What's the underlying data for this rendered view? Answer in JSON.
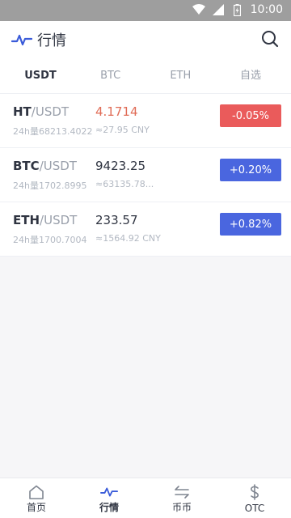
{
  "status": {
    "time": "10:00"
  },
  "header": {
    "title": "行情"
  },
  "tabs": [
    {
      "label": "USDT",
      "active": true
    },
    {
      "label": "BTC",
      "active": false
    },
    {
      "label": "ETH",
      "active": false
    },
    {
      "label": "自选",
      "active": false
    }
  ],
  "rows": [
    {
      "base": "HT",
      "quote": "/USDT",
      "volume": "24h量68213.4022",
      "price": "4.1714",
      "cny": "≈27.95 CNY",
      "change": "-0.05%",
      "direction": "down"
    },
    {
      "base": "BTC",
      "quote": "/USDT",
      "volume": "24h量1702.8995",
      "price": "9423.25",
      "cny": "≈63135.78...",
      "change": "+0.20%",
      "direction": "up"
    },
    {
      "base": "ETH",
      "quote": "/USDT",
      "volume": "24h量1700.7004",
      "price": "233.57",
      "cny": "≈1564.92 CNY",
      "change": "+0.82%",
      "direction": "up"
    }
  ],
  "bottom_nav": [
    {
      "label": "首页",
      "icon": "home-icon",
      "active": false
    },
    {
      "label": "行情",
      "icon": "market-pulse-icon",
      "active": true
    },
    {
      "label": "币币",
      "icon": "exchange-icon",
      "active": false
    },
    {
      "label": "OTC",
      "icon": "dollar-icon",
      "active": false
    }
  ],
  "colors": {
    "up": "#4a66df",
    "down": "#ea5b5b",
    "price_down": "#e06c56"
  }
}
